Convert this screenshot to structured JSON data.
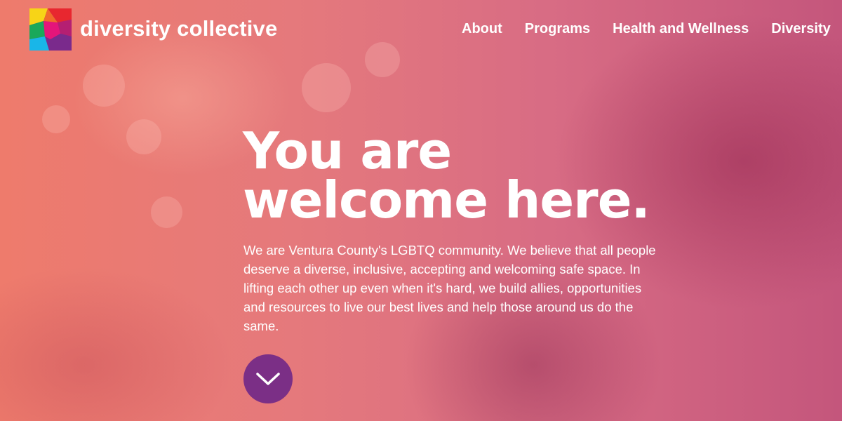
{
  "brand": {
    "name": "diversity collective",
    "colors": [
      "#f7d417",
      "#e4157a",
      "#19b6e8",
      "#7a2a8c",
      "#e8272f",
      "#1aa85a"
    ]
  },
  "nav": {
    "items": [
      {
        "label": "About"
      },
      {
        "label": "Programs"
      },
      {
        "label": "Health and Wellness"
      },
      {
        "label": "Diversity"
      }
    ]
  },
  "hero": {
    "headline_line1": "You are",
    "headline_line2": "welcome here.",
    "intro": "We are Ventura County's LGBTQ community. We believe that all people deserve a diverse, inclusive, accepting and welcoming safe space. In lifting each other up even when it's hard, we build allies, opportunities and resources to live our best lives and help those around us do the same.",
    "scroll_icon": "chevron-down-icon",
    "scroll_button_color": "#7b2f86"
  }
}
